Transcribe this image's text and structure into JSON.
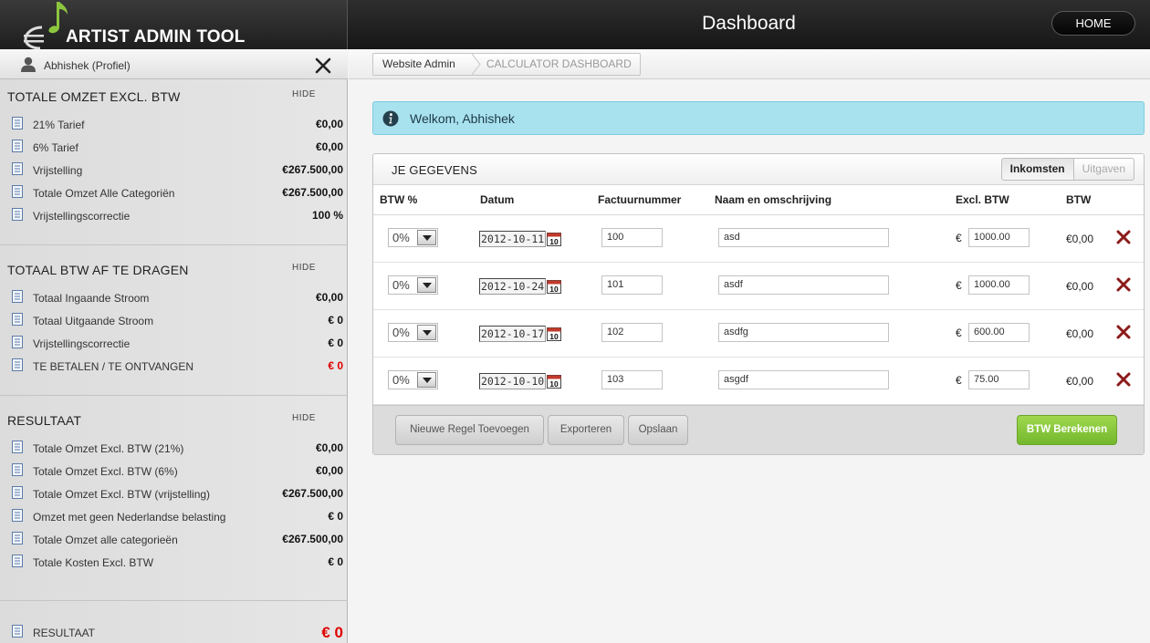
{
  "app": {
    "logo_text": "ARTIST ADMIN TOOL",
    "page_title": "Dashboard",
    "home_label": "HOME"
  },
  "profile": {
    "label": "Abhishek (Profiel)"
  },
  "sidebar": {
    "sections": [
      {
        "title": "TOTALE OMZET EXCL. BTW",
        "hide": "HIDE",
        "items": [
          {
            "label": "21% Tarief",
            "value": "€0,00"
          },
          {
            "label": "6% Tarief",
            "value": "€0,00"
          },
          {
            "label": "Vrijstelling",
            "value": "€267.500,00"
          },
          {
            "label": "Totale Omzet Alle Categoriën",
            "value": "€267.500,00"
          },
          {
            "label": "Vrijstellingscorrectie",
            "value": "100 %"
          }
        ]
      },
      {
        "title": "TOTAAL BTW AF TE DRAGEN",
        "hide": "HIDE",
        "items": [
          {
            "label": "Totaal Ingaande Stroom",
            "value": "€0,00"
          },
          {
            "label": "Totaal Uitgaande Stroom",
            "value": "€ 0"
          },
          {
            "label": "Vrijstellingscorrectie",
            "value": "€ 0"
          },
          {
            "label": "TE BETALEN / TE ONTVANGEN",
            "value": "€ 0"
          }
        ]
      },
      {
        "title": "RESULTAAT",
        "hide": "HIDE",
        "items": [
          {
            "label": "Totale Omzet Excl. BTW (21%)",
            "value": "€0,00"
          },
          {
            "label": "Totale Omzet Excl. BTW (6%)",
            "value": "€0,00"
          },
          {
            "label": "Totale Omzet Excl. BTW (vrijstelling)",
            "value": "€267.500,00"
          },
          {
            "label": "Omzet met geen Nederlandse belasting",
            "value": "€ 0"
          },
          {
            "label": "Totale Omzet alle categorieën",
            "value": "€267.500,00"
          },
          {
            "label": "Totale Kosten Excl. BTW",
            "value": "€ 0"
          }
        ]
      }
    ],
    "result": {
      "label": "RESULTAAT",
      "value": "€ 0"
    }
  },
  "breadcrumb": {
    "item1": "Website Admin",
    "item2": "CALCULATOR DASHBOARD"
  },
  "welcome": {
    "text": "Welkom, Abhishek"
  },
  "panel": {
    "title": "JE GEGEVENS",
    "tabs": {
      "active": "Inkomsten",
      "other": "Uitgaven"
    },
    "columns": {
      "btw": "BTW %",
      "datum": "Datum",
      "factuur": "Factuurnummer",
      "naam": "Naam en omschrijving",
      "excl": "Excl. BTW",
      "btw2": "BTW"
    },
    "rows": [
      {
        "btw": "0%",
        "date": "2012-10-11",
        "invoice": "100",
        "name": "asd",
        "currency": "€",
        "amount": "1000.00",
        "btw_value": "€0,00"
      },
      {
        "btw": "0%",
        "date": "2012-10-24",
        "invoice": "101",
        "name": "asdf",
        "currency": "€",
        "amount": "1000.00",
        "btw_value": "€0,00"
      },
      {
        "btw": "0%",
        "date": "2012-10-17",
        "invoice": "102",
        "name": "asdfg",
        "currency": "€",
        "amount": "600.00",
        "btw_value": "€0,00"
      },
      {
        "btw": "0%",
        "date": "2012-10-10",
        "invoice": "103",
        "name": "asgdf",
        "currency": "€",
        "amount": "75.00",
        "btw_value": "€0,00"
      }
    ],
    "buttons": {
      "add": "Nieuwe Regel Toevoegen",
      "export": "Exporteren",
      "save": "Opslaan",
      "calc": "BTW Berekenen"
    }
  },
  "colors": {
    "accent_green": "#8cc63f",
    "warning_red": "#e00000",
    "info_bg": "#a9e2ef",
    "delete_red": "#8b1a1a"
  }
}
